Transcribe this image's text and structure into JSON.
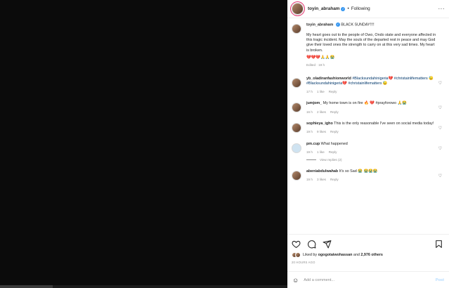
{
  "header": {
    "username": "toyin_abraham",
    "separator": "•",
    "follow_label": "Following",
    "more": "···"
  },
  "caption": {
    "username": "toyin_abraham",
    "title": "BLACK SUNDAY!!!!",
    "body": "My heart goes out to the people of Owo, Ondo state and everyone affected in this tragic incident. May the souls of the departed rest in peace and may God give their loved ones the strength to carry on at this very sad times. My heart is broken.",
    "emojis": "💔💔💔🙏🙏😭",
    "meta": "Edited · 19 h"
  },
  "comments": [
    {
      "username": "yb_oladiranfashionworld",
      "text": "#Blacksundahinigeria💔 #christainlifematters 😓#Blacksundahinigeria💔 #christainlifematters 😓",
      "time": "17 h",
      "likes": "1 like",
      "reply": "Reply"
    },
    {
      "username": "jumjom_",
      "text": "My home town is on fire 🔥 💔 #prayforowo 🙏😭",
      "time": "16 h",
      "likes": "2 likes",
      "reply": "Reply"
    },
    {
      "username": "sophieya_igho",
      "text": "This is the only reasonable I've seen on social media today!",
      "time": "19 h",
      "likes": "9 likes",
      "reply": "Reply"
    },
    {
      "username": "pm.cup",
      "text": "What happened",
      "time": "19 h",
      "likes": "1 like",
      "reply": "Reply",
      "view_replies": "View replies (2)"
    },
    {
      "username": "abeniabdulwahab",
      "text": "It's so Sad 😭 😭😭😭",
      "time": "19 h",
      "likes": "3 likes",
      "reply": "Reply"
    }
  ],
  "likes": {
    "prefix": "Liked by",
    "user": "ogogotaiwohassan",
    "suffix": "and",
    "count": "2,976 others"
  },
  "timestamp": "20 HOURS AGO",
  "add_comment": {
    "placeholder": "Add a comment...",
    "post_label": "Post"
  },
  "colors": {
    "link": "#00376b",
    "verified": "#3897f0",
    "muted": "#8e8e8e",
    "post_disabled": "#b3dbff"
  },
  "icons": [
    "heart-icon",
    "comment-icon",
    "share-icon",
    "bookmark-icon",
    "emoji-icon",
    "more-icon",
    "verified-icon"
  ]
}
